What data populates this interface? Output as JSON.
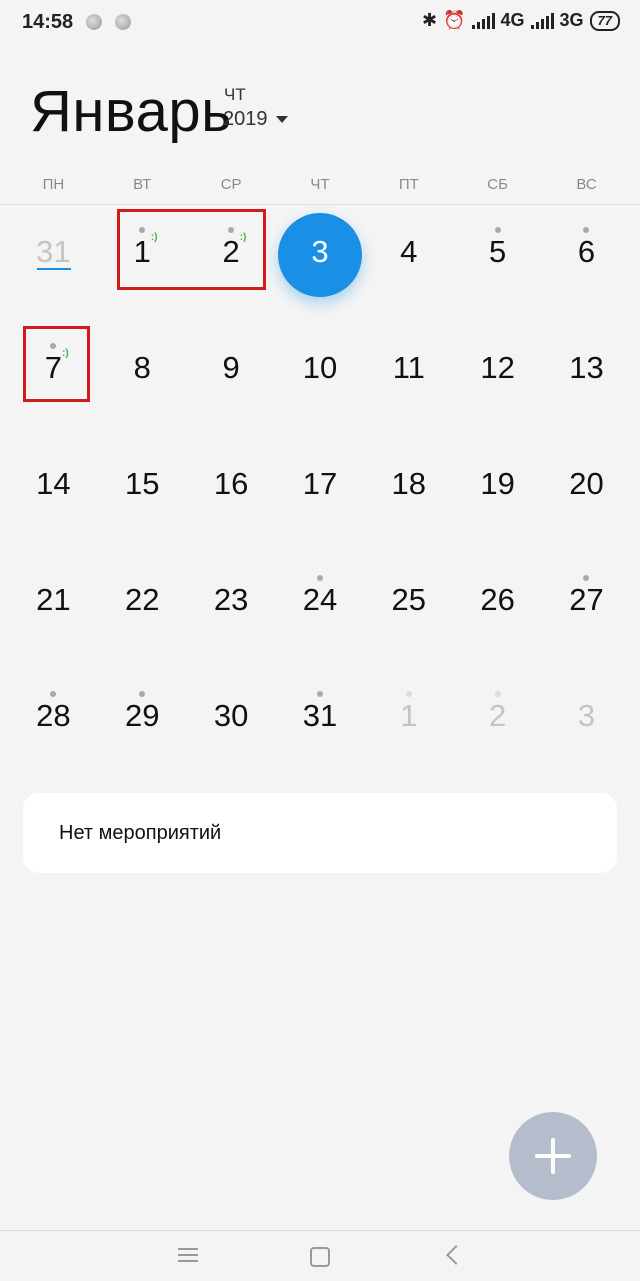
{
  "status_bar": {
    "time": "14:58",
    "network_1": "4G",
    "network_2": "3G",
    "battery": "77"
  },
  "header": {
    "month": "Январь",
    "weekday": "ЧТ",
    "year": "2019"
  },
  "weekday_labels": [
    "ПН",
    "ВТ",
    "СР",
    "ЧТ",
    "ПТ",
    "СБ",
    "ВС"
  ],
  "calendar": {
    "weeks": [
      [
        {
          "label": "31",
          "muted": true,
          "dot": false
        },
        {
          "label": "1",
          "dot": true,
          "smiley": true
        },
        {
          "label": "2",
          "dot": true,
          "smiley": true
        },
        {
          "label": "3",
          "today": true
        },
        {
          "label": "4"
        },
        {
          "label": "5",
          "dot": true
        },
        {
          "label": "6",
          "dot": true
        }
      ],
      [
        {
          "label": "7",
          "dot": true,
          "smiley": true
        },
        {
          "label": "8"
        },
        {
          "label": "9"
        },
        {
          "label": "10"
        },
        {
          "label": "11"
        },
        {
          "label": "12"
        },
        {
          "label": "13"
        }
      ],
      [
        {
          "label": "14"
        },
        {
          "label": "15"
        },
        {
          "label": "16"
        },
        {
          "label": "17"
        },
        {
          "label": "18"
        },
        {
          "label": "19"
        },
        {
          "label": "20"
        }
      ],
      [
        {
          "label": "21"
        },
        {
          "label": "22"
        },
        {
          "label": "23"
        },
        {
          "label": "24",
          "dot": true
        },
        {
          "label": "25"
        },
        {
          "label": "26"
        },
        {
          "label": "27",
          "dot": true
        }
      ],
      [
        {
          "label": "28",
          "dot": true
        },
        {
          "label": "29",
          "dot": true
        },
        {
          "label": "30"
        },
        {
          "label": "31",
          "dot": true
        },
        {
          "label": "1",
          "muted": true,
          "dot": true
        },
        {
          "label": "2",
          "muted": true,
          "dot": true
        },
        {
          "label": "3",
          "muted": true
        }
      ]
    ],
    "smiley_text": ":)"
  },
  "events": {
    "empty_text": "Нет мероприятий"
  },
  "colors": {
    "accent": "#1a8fe6",
    "highlight_box": "#d11a1a",
    "fab": "#b5bdcc",
    "smiley": "#3bb34a"
  },
  "icons": {
    "add": "plus-icon",
    "nav_menu": "menu-icon",
    "nav_home": "home-icon",
    "nav_back": "back-icon"
  }
}
